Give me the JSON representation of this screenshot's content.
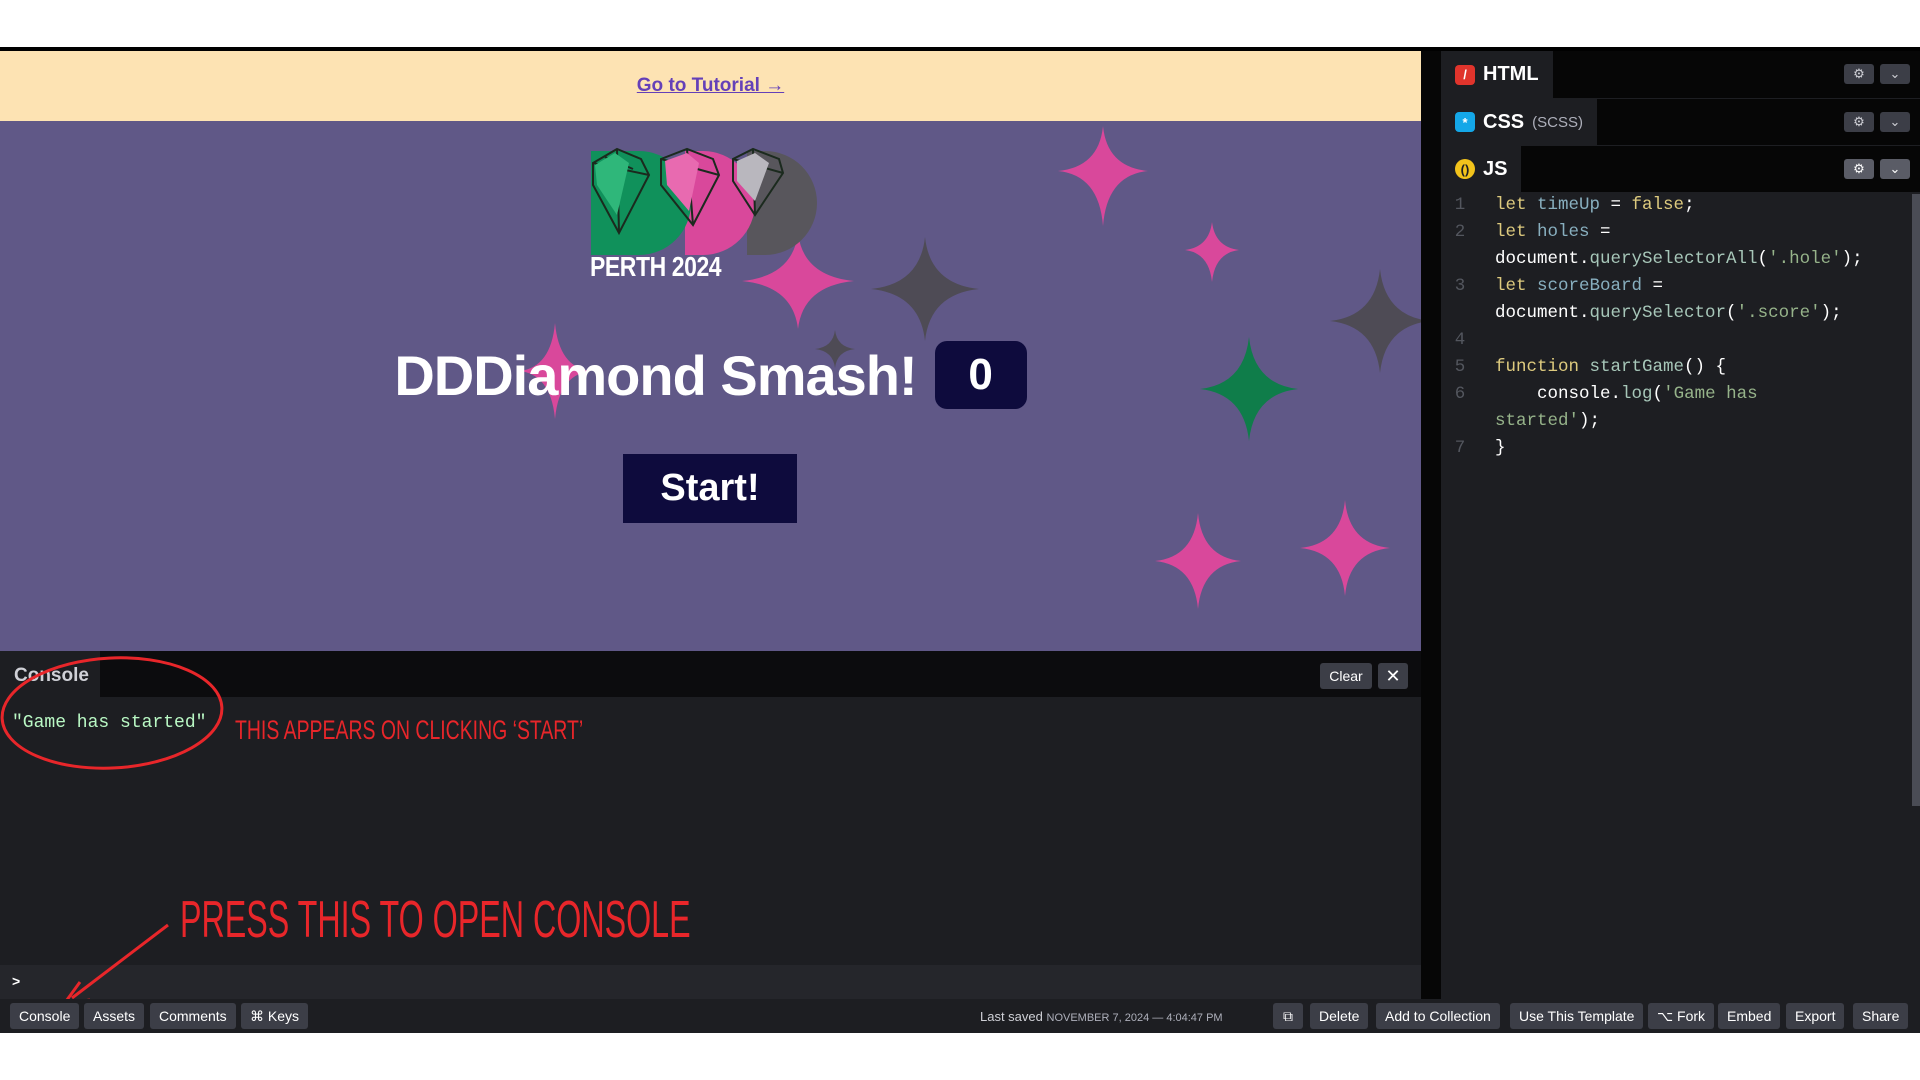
{
  "preview": {
    "tutorial_link": "Go to Tutorial →",
    "logo_text": "PERTH 2024",
    "game_title": "DDDiamond Smash!",
    "score": "0",
    "start_button": "Start!"
  },
  "console": {
    "tab_label": "Console",
    "clear_label": "Clear",
    "close_label": "✕",
    "message": "\"Game has started\"",
    "prompt": ">"
  },
  "annotations": {
    "click_note": "This appears on clicking ‘Start’",
    "press_note": "Press this to open console"
  },
  "editor": {
    "tabs": [
      {
        "label": "HTML",
        "sub": "",
        "icon": "/",
        "icon_color": "#e0342c"
      },
      {
        "label": "CSS",
        "sub": "(SCSS)",
        "icon": "*",
        "icon_color": "#14a7e8"
      },
      {
        "label": "JS",
        "sub": "",
        "icon": "()",
        "icon_color": "#f2c31b"
      }
    ],
    "line_numbers": [
      "1",
      "2",
      "",
      "3",
      "",
      "4",
      "5",
      "6",
      "",
      "7"
    ],
    "lines": [
      [
        [
          "kw",
          "let "
        ],
        [
          "var",
          "timeUp"
        ],
        [
          "pl",
          " = "
        ],
        [
          "kw",
          "false"
        ],
        [
          "pl",
          ";"
        ]
      ],
      [
        [
          "kw",
          "let "
        ],
        [
          "var",
          "holes"
        ],
        [
          "pl",
          " ="
        ]
      ],
      [
        [
          "pl",
          "document."
        ],
        [
          "fn",
          "querySelectorAll"
        ],
        [
          "pl",
          "("
        ],
        [
          "str",
          "'.hole'"
        ],
        [
          "pl",
          ");"
        ]
      ],
      [
        [
          "kw",
          "let "
        ],
        [
          "var",
          "scoreBoard"
        ],
        [
          "pl",
          " ="
        ]
      ],
      [
        [
          "pl",
          "document."
        ],
        [
          "fn",
          "querySelector"
        ],
        [
          "pl",
          "("
        ],
        [
          "str",
          "'.score'"
        ],
        [
          "pl",
          ");"
        ]
      ],
      [
        [
          "pl",
          ""
        ]
      ],
      [
        [
          "kw",
          "function "
        ],
        [
          "fn",
          "startGame"
        ],
        [
          "pl",
          "() {"
        ]
      ],
      [
        [
          "pl",
          "    console."
        ],
        [
          "fn",
          "log"
        ],
        [
          "pl",
          "("
        ],
        [
          "str",
          "'Game has"
        ]
      ],
      [
        [
          "str",
          "started'"
        ],
        [
          "pl",
          ");"
        ]
      ],
      [
        [
          "pl",
          "}"
        ]
      ]
    ]
  },
  "footer": {
    "left_buttons": [
      "Console",
      "Assets",
      "Comments",
      "⌘ Keys"
    ],
    "last_saved_label": "Last saved",
    "last_saved_date": "November 7, 2024 — 4:04:47 PM",
    "right_buttons": [
      "⧉",
      "Delete",
      "Add to Collection",
      "Use This Template",
      "⌥ Fork",
      "Embed",
      "Export",
      "Share"
    ]
  },
  "colors": {
    "preview_bg": "#605887",
    "tutorial_bar": "#fde3b3",
    "accent_pink": "#d9489b",
    "accent_green": "#0f7d4a",
    "star_gray": "#4e4b55",
    "navy": "#0e0b3d",
    "annotation_red": "#e8262a"
  }
}
